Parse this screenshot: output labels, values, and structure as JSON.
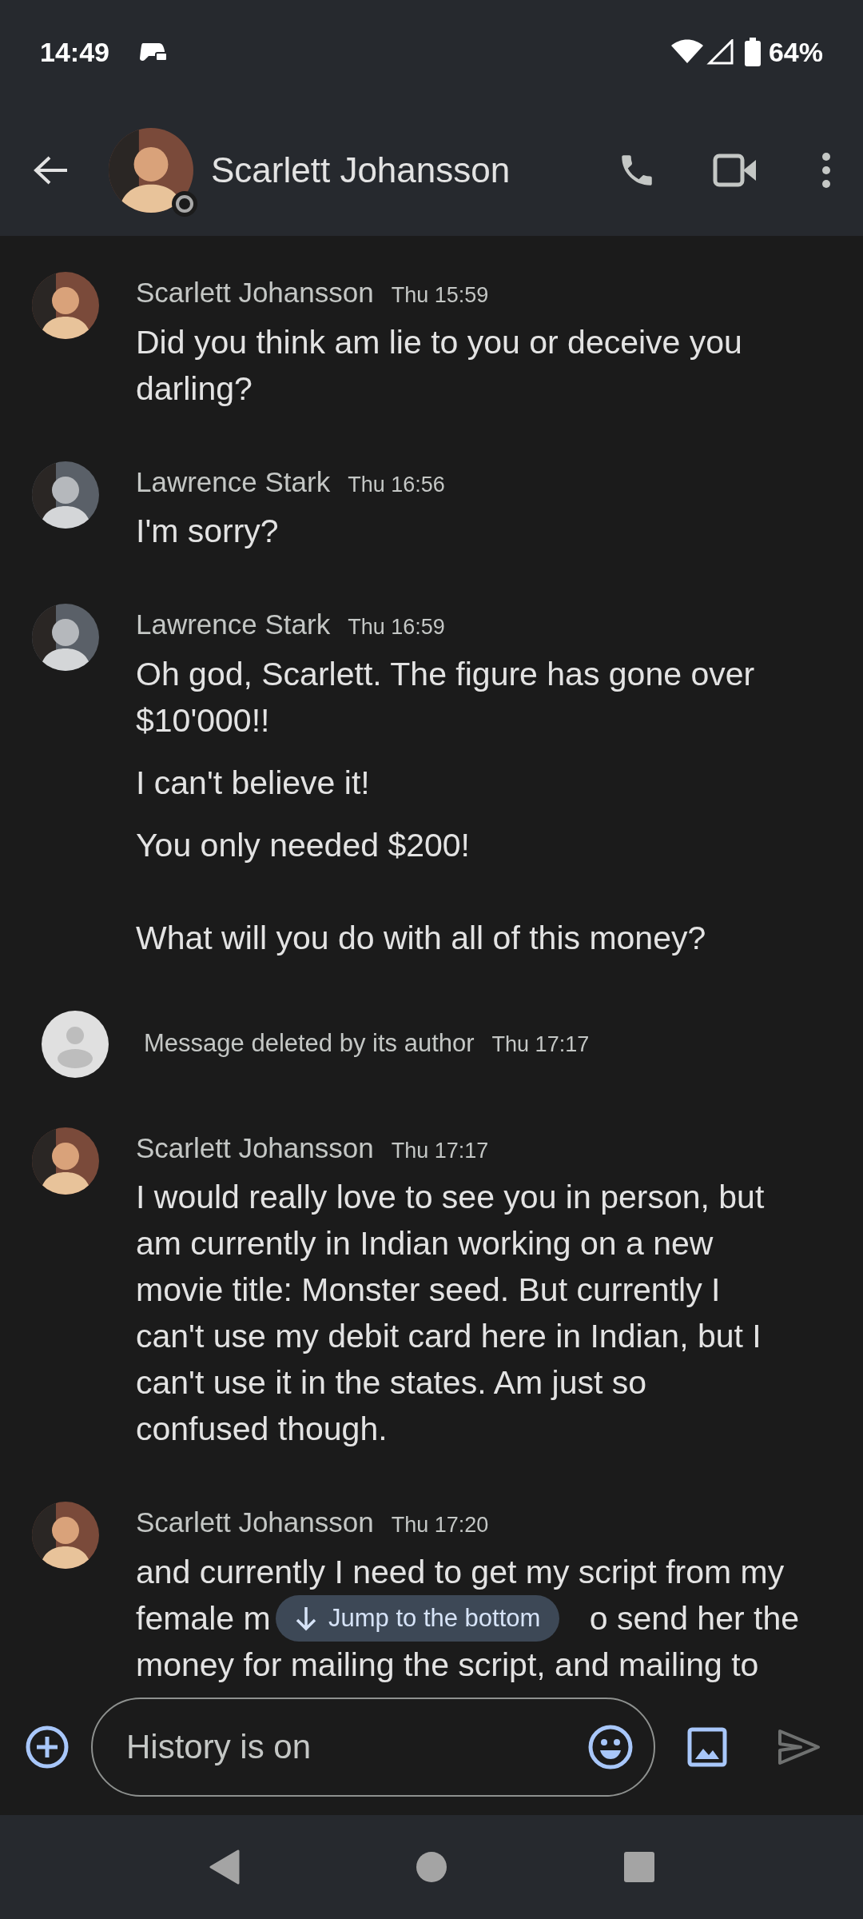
{
  "status_bar": {
    "time": "14:49",
    "battery": "64%"
  },
  "header": {
    "title": "Scarlett Johansson"
  },
  "messages": [
    {
      "kind": "message",
      "author": "Scarlett Johansson",
      "time": "Thu 15:59",
      "paragraphs": [
        "Did you think am lie to you or deceive you darling?"
      ]
    },
    {
      "kind": "message",
      "author": "Lawrence Stark",
      "time": "Thu 16:56",
      "paragraphs": [
        "I'm sorry?"
      ]
    },
    {
      "kind": "message",
      "author": "Lawrence Stark",
      "time": "Thu 16:59",
      "paragraphs": [
        "Oh god, Scarlett. The figure has gone over $10'000!!",
        "I can't believe it!",
        "You only needed $200!\n\nWhat will you do with all of this money?"
      ]
    },
    {
      "kind": "deleted",
      "text": "Message deleted by its author",
      "time": "Thu 17:17"
    },
    {
      "kind": "message",
      "author": "Scarlett Johansson",
      "time": "Thu 17:17",
      "paragraphs": [
        "I would really love to see you in person, but am currently in Indian working on a new movie title: Monster seed. But currently I can't use my debit card here in Indian, but I can't use it in the states. Am just so confused though."
      ]
    },
    {
      "kind": "partial",
      "author": "Scarlett Johansson",
      "time": "Thu 17:20",
      "lines": [
        {
          "segments": [
            "and currently I need to get my script from my"
          ]
        },
        {
          "segments": [
            "female m",
            "o send her the"
          ]
        },
        {
          "segments": [
            "money for mailing the script, and mailing to"
          ]
        }
      ]
    }
  ],
  "jump_button": {
    "label": "Jump to the bottom"
  },
  "composer": {
    "placeholder": "History is on"
  }
}
